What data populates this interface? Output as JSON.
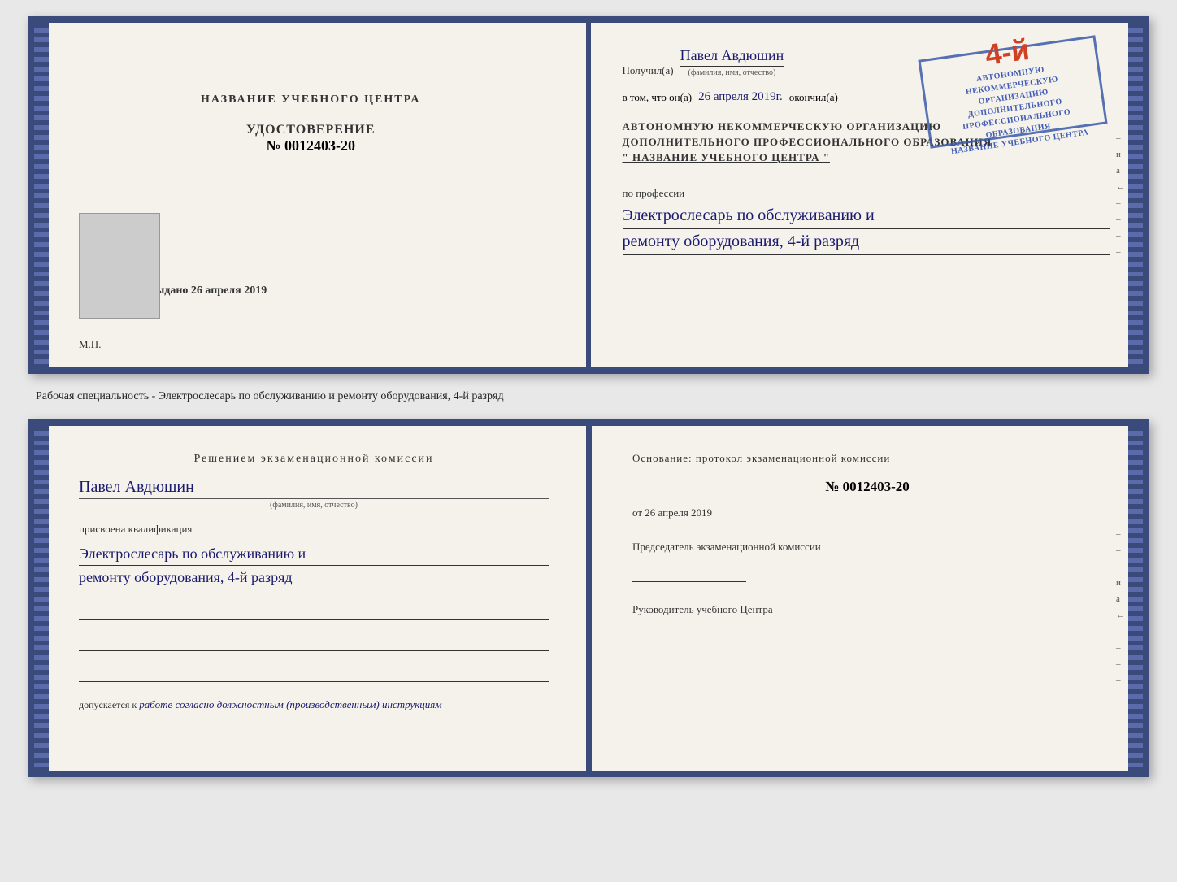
{
  "top_cert": {
    "left": {
      "title": "НАЗВАНИЕ УЧЕБНОГО ЦЕНТРА",
      "cert_label": "УДОСТОВЕРЕНИЕ",
      "cert_number": "№ 0012403-20",
      "vydano_label": "Выдано",
      "vydano_date": "26 апреля 2019",
      "mp_label": "М.П."
    },
    "right": {
      "poluchil_label": "Получил(a)",
      "name_value": "Павел Авдюшин",
      "name_subtext": "(фамилия, имя, отчество)",
      "vtom_label": "в том, что он(а)",
      "date_value": "26 апреля 2019г.",
      "okonchil_label": "окончил(а)",
      "org_line1": "АВТОНОМНУЮ НЕКОММЕРЧЕСКУЮ ОРГАНИЗАЦИЮ",
      "org_line2": "ДОПОЛНИТЕЛЬНОГО ПРОФЕССИОНАЛЬНОГО ОБРАЗОВАНИЯ",
      "org_name": "\" НАЗВАНИЕ УЧЕБНОГО ЦЕНТРА \"",
      "stamp_number": "4-й",
      "stamp_line1": "АВТОНОМНУЮ НЕКОММЕРЧЕСКУЮ ОРГАНИЗАЦИЮ",
      "stamp_line2": "ДОПОЛНИТЕЛЬНОГО ПРОФЕССИОНАЛЬНОГО ОБРАЗОВАНИЯ",
      "stamp_line3": "НАЗВАНИЕ УЧЕБНОГО ЦЕНТРА",
      "po_professii": "по профессии",
      "prof_line1": "Электрослесарь по обслуживанию и",
      "prof_line2": "ремонту оборудования, 4-й разряд"
    }
  },
  "work_specialty": "Рабочая специальность - Электрослесарь по обслуживанию и ремонту оборудования, 4-й разряд",
  "bottom_cert": {
    "left": {
      "heading": "Решением экзаменационной комиссии",
      "name_value": "Павел Авдюшин",
      "name_subtext": "(фамилия, имя, отчество)",
      "prisvoena": "присвоена квалификация",
      "prof_line1": "Электрослесарь по обслуживанию и",
      "prof_line2": "ремонту оборудования, 4-й разряд",
      "dopusk_label": "допускается к",
      "dopusk_text": "работе согласно должностным (производственным) инструкциям"
    },
    "right": {
      "osnov_label": "Основание: протокол экзаменационной комиссии",
      "number_value": "№ 0012403-20",
      "date_prefix": "от",
      "date_value": "26 апреля 2019",
      "chair_label": "Председатель экзаменационной комиссии",
      "ruk_label": "Руководитель учебного Центра"
    },
    "side_chars": [
      "и",
      "а",
      "←",
      "–",
      "–",
      "–",
      "–",
      "–"
    ]
  }
}
